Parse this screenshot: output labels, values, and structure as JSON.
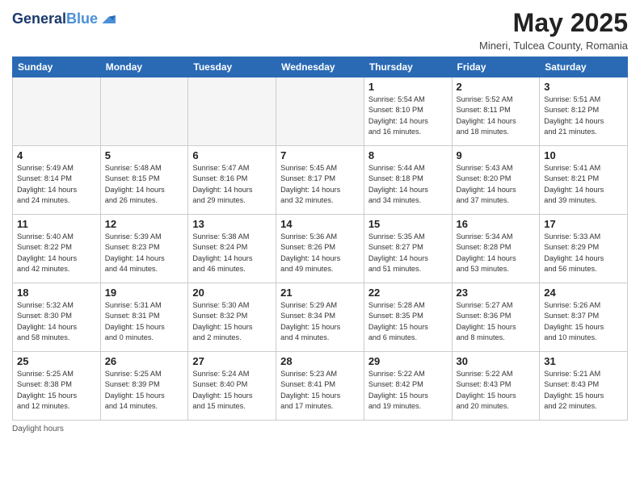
{
  "header": {
    "logo_line1": "General",
    "logo_line2": "Blue",
    "month_title": "May 2025",
    "subtitle": "Mineri, Tulcea County, Romania"
  },
  "days_of_week": [
    "Sunday",
    "Monday",
    "Tuesday",
    "Wednesday",
    "Thursday",
    "Friday",
    "Saturday"
  ],
  "weeks": [
    [
      {
        "num": "",
        "info": ""
      },
      {
        "num": "",
        "info": ""
      },
      {
        "num": "",
        "info": ""
      },
      {
        "num": "",
        "info": ""
      },
      {
        "num": "1",
        "info": "Sunrise: 5:54 AM\nSunset: 8:10 PM\nDaylight: 14 hours\nand 16 minutes."
      },
      {
        "num": "2",
        "info": "Sunrise: 5:52 AM\nSunset: 8:11 PM\nDaylight: 14 hours\nand 18 minutes."
      },
      {
        "num": "3",
        "info": "Sunrise: 5:51 AM\nSunset: 8:12 PM\nDaylight: 14 hours\nand 21 minutes."
      }
    ],
    [
      {
        "num": "4",
        "info": "Sunrise: 5:49 AM\nSunset: 8:14 PM\nDaylight: 14 hours\nand 24 minutes."
      },
      {
        "num": "5",
        "info": "Sunrise: 5:48 AM\nSunset: 8:15 PM\nDaylight: 14 hours\nand 26 minutes."
      },
      {
        "num": "6",
        "info": "Sunrise: 5:47 AM\nSunset: 8:16 PM\nDaylight: 14 hours\nand 29 minutes."
      },
      {
        "num": "7",
        "info": "Sunrise: 5:45 AM\nSunset: 8:17 PM\nDaylight: 14 hours\nand 32 minutes."
      },
      {
        "num": "8",
        "info": "Sunrise: 5:44 AM\nSunset: 8:18 PM\nDaylight: 14 hours\nand 34 minutes."
      },
      {
        "num": "9",
        "info": "Sunrise: 5:43 AM\nSunset: 8:20 PM\nDaylight: 14 hours\nand 37 minutes."
      },
      {
        "num": "10",
        "info": "Sunrise: 5:41 AM\nSunset: 8:21 PM\nDaylight: 14 hours\nand 39 minutes."
      }
    ],
    [
      {
        "num": "11",
        "info": "Sunrise: 5:40 AM\nSunset: 8:22 PM\nDaylight: 14 hours\nand 42 minutes."
      },
      {
        "num": "12",
        "info": "Sunrise: 5:39 AM\nSunset: 8:23 PM\nDaylight: 14 hours\nand 44 minutes."
      },
      {
        "num": "13",
        "info": "Sunrise: 5:38 AM\nSunset: 8:24 PM\nDaylight: 14 hours\nand 46 minutes."
      },
      {
        "num": "14",
        "info": "Sunrise: 5:36 AM\nSunset: 8:26 PM\nDaylight: 14 hours\nand 49 minutes."
      },
      {
        "num": "15",
        "info": "Sunrise: 5:35 AM\nSunset: 8:27 PM\nDaylight: 14 hours\nand 51 minutes."
      },
      {
        "num": "16",
        "info": "Sunrise: 5:34 AM\nSunset: 8:28 PM\nDaylight: 14 hours\nand 53 minutes."
      },
      {
        "num": "17",
        "info": "Sunrise: 5:33 AM\nSunset: 8:29 PM\nDaylight: 14 hours\nand 56 minutes."
      }
    ],
    [
      {
        "num": "18",
        "info": "Sunrise: 5:32 AM\nSunset: 8:30 PM\nDaylight: 14 hours\nand 58 minutes."
      },
      {
        "num": "19",
        "info": "Sunrise: 5:31 AM\nSunset: 8:31 PM\nDaylight: 15 hours\nand 0 minutes."
      },
      {
        "num": "20",
        "info": "Sunrise: 5:30 AM\nSunset: 8:32 PM\nDaylight: 15 hours\nand 2 minutes."
      },
      {
        "num": "21",
        "info": "Sunrise: 5:29 AM\nSunset: 8:34 PM\nDaylight: 15 hours\nand 4 minutes."
      },
      {
        "num": "22",
        "info": "Sunrise: 5:28 AM\nSunset: 8:35 PM\nDaylight: 15 hours\nand 6 minutes."
      },
      {
        "num": "23",
        "info": "Sunrise: 5:27 AM\nSunset: 8:36 PM\nDaylight: 15 hours\nand 8 minutes."
      },
      {
        "num": "24",
        "info": "Sunrise: 5:26 AM\nSunset: 8:37 PM\nDaylight: 15 hours\nand 10 minutes."
      }
    ],
    [
      {
        "num": "25",
        "info": "Sunrise: 5:25 AM\nSunset: 8:38 PM\nDaylight: 15 hours\nand 12 minutes."
      },
      {
        "num": "26",
        "info": "Sunrise: 5:25 AM\nSunset: 8:39 PM\nDaylight: 15 hours\nand 14 minutes."
      },
      {
        "num": "27",
        "info": "Sunrise: 5:24 AM\nSunset: 8:40 PM\nDaylight: 15 hours\nand 15 minutes."
      },
      {
        "num": "28",
        "info": "Sunrise: 5:23 AM\nSunset: 8:41 PM\nDaylight: 15 hours\nand 17 minutes."
      },
      {
        "num": "29",
        "info": "Sunrise: 5:22 AM\nSunset: 8:42 PM\nDaylight: 15 hours\nand 19 minutes."
      },
      {
        "num": "30",
        "info": "Sunrise: 5:22 AM\nSunset: 8:43 PM\nDaylight: 15 hours\nand 20 minutes."
      },
      {
        "num": "31",
        "info": "Sunrise: 5:21 AM\nSunset: 8:43 PM\nDaylight: 15 hours\nand 22 minutes."
      }
    ]
  ],
  "footer": {
    "daylight_label": "Daylight hours"
  }
}
